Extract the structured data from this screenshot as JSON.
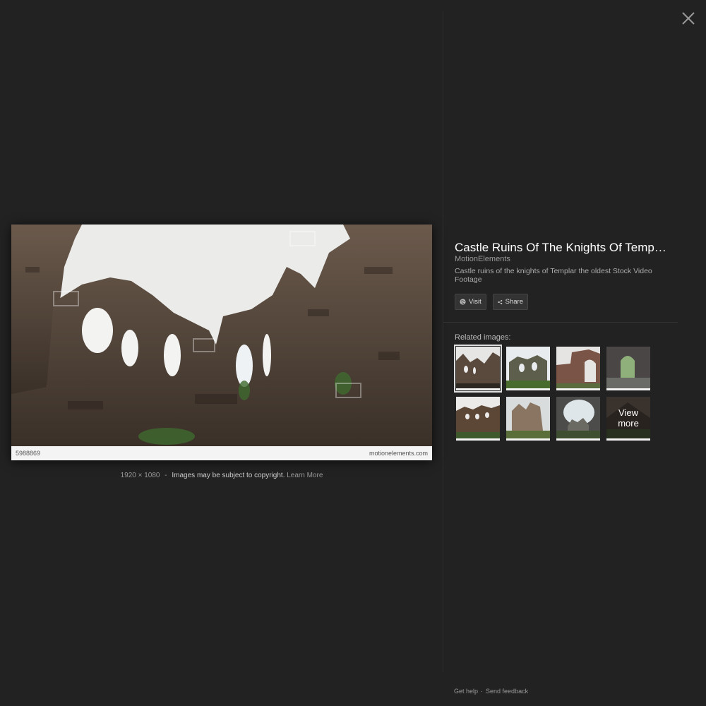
{
  "viewer": {
    "image_id_label": "5988869",
    "image_site_label": "motionelements.com",
    "dimensions": "1920 × 1080",
    "dash": "-",
    "copyright_text": "Images may be subject to copyright.",
    "learn_more": "Learn More"
  },
  "panel": {
    "title": "Castle Ruins Of The Knights Of Templar the oldest Stock Video Footage",
    "source": "MotionElements",
    "description": "Castle ruins of the knights of Templar the oldest Stock Video Footage",
    "visit_label": "Visit",
    "share_label": "Share",
    "related_label": "Related images:",
    "view_more_line1": "View",
    "view_more_line2": "more"
  },
  "footer": {
    "get_help": "Get help",
    "dot": "·",
    "send_feedback": "Send feedback"
  },
  "colors": {
    "background": "#222222",
    "stone": "#5a4a3e",
    "sky": "#e8e8e6"
  }
}
